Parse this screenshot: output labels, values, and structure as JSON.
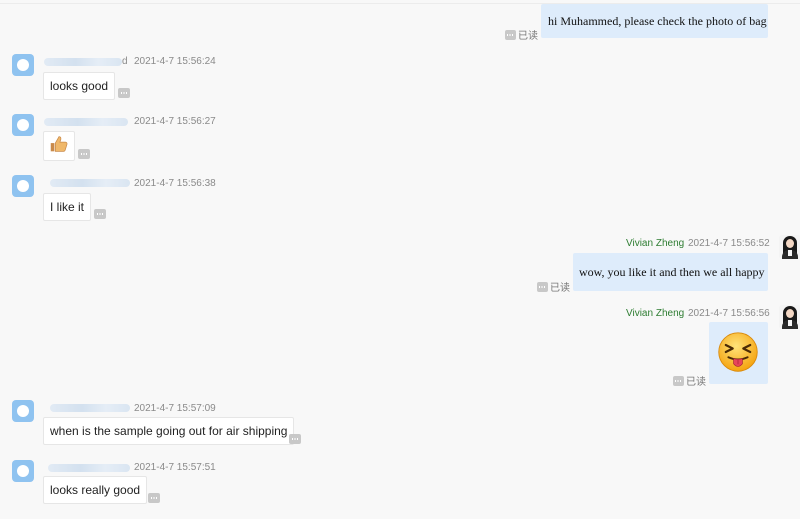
{
  "messages": [
    {
      "id": "m0",
      "side": "out",
      "text": "hi Muhammed, please check the photo of bag",
      "read_label": "已读"
    },
    {
      "id": "m1",
      "side": "in",
      "name_visible": "d",
      "timestamp": "2021-4-7 15:56:24",
      "text": "looks good"
    },
    {
      "id": "m2",
      "side": "in",
      "name_visible": "",
      "timestamp": "2021-4-7 15:56:27",
      "content_type": "emoji",
      "emoji_icon": "thumbs-up-icon"
    },
    {
      "id": "m3",
      "side": "in",
      "name_visible": "",
      "timestamp": "2021-4-7 15:56:38",
      "text": "I like it"
    },
    {
      "id": "m4",
      "side": "out",
      "sender": "Vivian Zheng",
      "timestamp": "2021-4-7 15:56:52",
      "text": "wow, you like it and then we all happy",
      "read_label": "已读"
    },
    {
      "id": "m5",
      "side": "out",
      "sender": "Vivian Zheng",
      "timestamp": "2021-4-7 15:56:56",
      "content_type": "emoji",
      "emoji_icon": "tongue-out-squint-face-icon",
      "read_label": "已读"
    },
    {
      "id": "m6",
      "side": "in",
      "name_visible": "",
      "timestamp": "2021-4-7 15:57:09",
      "text": "when is the sample going out for air shipping"
    },
    {
      "id": "m7",
      "side": "in",
      "name_visible": "",
      "timestamp": "2021-4-7 15:57:51",
      "text": "looks really good"
    }
  ],
  "colors": {
    "background": "#f8f8f8",
    "outgoing_bubble": "#deecfb",
    "incoming_bubble": "#ffffff",
    "sender_name": "#2e7d32",
    "timestamp": "#8a8a8a",
    "customer_avatar": "#8fc3f0"
  }
}
